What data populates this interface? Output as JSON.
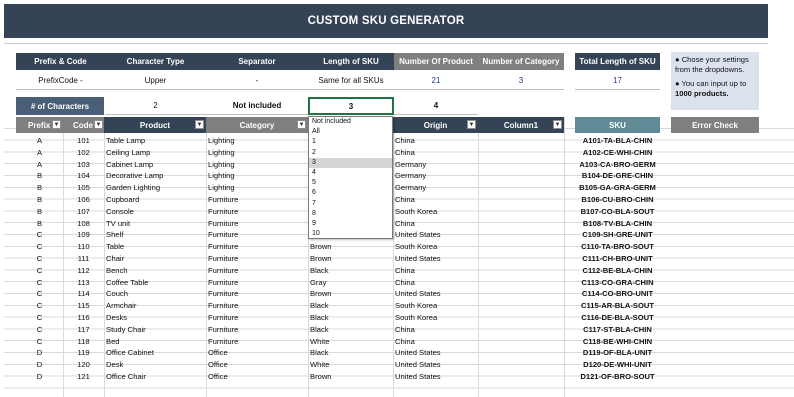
{
  "title": "CUSTOM SKU GENERATOR",
  "settings": {
    "headers": [
      "Prefix & Code",
      "Character Type",
      "Separator",
      "Length of SKU",
      "Number Of Product",
      "Number of Category"
    ],
    "values": [
      "PrefixCode -",
      "Upper",
      "-",
      "Same for all SKUs",
      "21",
      "3"
    ]
  },
  "total_length": {
    "header": "Total Length of SKU",
    "value": "17"
  },
  "note": {
    "line1": "● Chose your settings from the dropdowns.",
    "line2_prefix": "● You can input up to ",
    "line2_bold": "1000 products."
  },
  "chars_row": {
    "label": "# of Characters",
    "values": [
      "2",
      "Not included",
      "3",
      "4"
    ]
  },
  "table": {
    "headers": [
      "Prefix",
      "Code",
      "Product",
      "Category",
      "",
      "Origin",
      "Column1"
    ],
    "rows": [
      [
        "A",
        "101",
        "Table Lamp",
        "Lighting",
        "",
        "China"
      ],
      [
        "A",
        "102",
        "Ceiling Lamp",
        "Lighting",
        "",
        "China"
      ],
      [
        "A",
        "103",
        "Cabinet Lamp",
        "Lighting",
        "",
        "Germany"
      ],
      [
        "B",
        "104",
        "Decorative Lamp",
        "Lighting",
        "",
        "Germany"
      ],
      [
        "B",
        "105",
        "Garden Lighting",
        "Lighting",
        "",
        "Germany"
      ],
      [
        "B",
        "106",
        "Cupboard",
        "Furniture",
        "",
        "China"
      ],
      [
        "B",
        "107",
        "Console",
        "Furniture",
        "",
        "South Korea"
      ],
      [
        "B",
        "108",
        "TV unit",
        "Furniture",
        "",
        "China"
      ],
      [
        "C",
        "109",
        "Shelf",
        "Furniture",
        "",
        "United States"
      ],
      [
        "C",
        "110",
        "Table",
        "Furniture",
        "Brown",
        "South Korea"
      ],
      [
        "C",
        "111",
        "Chair",
        "Furniture",
        "Brown",
        "United States"
      ],
      [
        "C",
        "112",
        "Bench",
        "Furniture",
        "Black",
        "China"
      ],
      [
        "C",
        "113",
        "Coffee Table",
        "Furniture",
        "Gray",
        "China"
      ],
      [
        "C",
        "114",
        "Couch",
        "Furniture",
        "Brown",
        "United States"
      ],
      [
        "C",
        "115",
        "Armchair",
        "Furniture",
        "Black",
        "South Korea"
      ],
      [
        "C",
        "116",
        "Desks",
        "Furniture",
        "Black",
        "South Korea"
      ],
      [
        "C",
        "117",
        "Study Chair",
        "Furniture",
        "Black",
        "China"
      ],
      [
        "C",
        "118",
        "Bed",
        "Furniture",
        "White",
        "China"
      ],
      [
        "D",
        "119",
        "Office Cabinet",
        "Office",
        "Black",
        "United States"
      ],
      [
        "D",
        "120",
        "Desk",
        "Office",
        "White",
        "United States"
      ],
      [
        "D",
        "121",
        "Office Chair",
        "Office",
        "Brown",
        "United States"
      ]
    ]
  },
  "sku": {
    "header": "SKU",
    "values": [
      "A101-TA-BLA-CHIN",
      "A102-CE-WHI-CHIN",
      "A103-CA-BRO-GERM",
      "B104-DE-GRE-CHIN",
      "B105-GA-GRA-GERM",
      "B106-CU-BRO-CHIN",
      "B107-CO-BLA-SOUT",
      "B108-TV-BLA-CHIN",
      "C109-SH-GRE-UNIT",
      "C110-TA-BRO-SOUT",
      "C111-CH-BRO-UNIT",
      "C112-BE-BLA-CHIN",
      "C113-CO-GRA-CHIN",
      "C114-CO-BRO-UNIT",
      "C115-AR-BLA-SOUT",
      "C116-DE-BLA-SOUT",
      "C117-ST-BLA-CHIN",
      "C118-BE-WHI-CHIN",
      "D119-OF-BLA-UNIT",
      "D120-DE-WHI-UNIT",
      "D121-OF-BRO-SOUT"
    ]
  },
  "error_check": {
    "header": "Error Check"
  },
  "dropdown": {
    "options": [
      "Not included",
      "All",
      "1",
      "2",
      "3",
      "4",
      "5",
      "6",
      "7",
      "8",
      "9",
      "10"
    ],
    "selected": "3"
  },
  "icons": {
    "filter": "filter-dropdown-icon",
    "chevron": "chevron-down-icon"
  }
}
